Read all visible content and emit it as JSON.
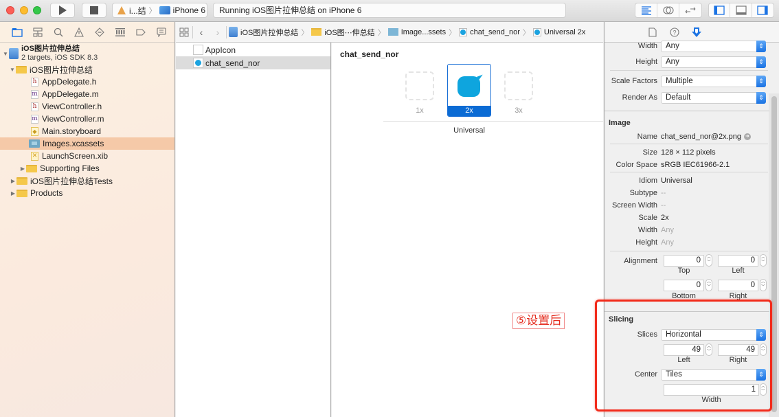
{
  "toolbar": {
    "scheme_target": "i...结",
    "scheme_device": "iPhone 6",
    "activity_text": "Running iOS图片拉伸总结 on iPhone 6",
    "icons": [
      "close-window",
      "minimize-window",
      "zoom-window",
      "run",
      "stop",
      "standard-editor",
      "assistant-editor",
      "version-editor",
      "toggle-navigator",
      "toggle-debug-area",
      "toggle-utilities"
    ]
  },
  "navigator": {
    "tabs": [
      "project-navigator",
      "symbol-navigator",
      "find-navigator",
      "issue-navigator",
      "test-navigator",
      "debug-navigator",
      "breakpoint-navigator",
      "report-navigator"
    ],
    "project": {
      "name": "iOS图片拉伸总结",
      "subtitle": "2 targets, iOS SDK 8.3"
    },
    "items": [
      {
        "label": "iOS图片拉伸总结",
        "type": "folder",
        "expanded": true
      },
      {
        "label": "AppDelegate.h",
        "type": "h"
      },
      {
        "label": "AppDelegate.m",
        "type": "m"
      },
      {
        "label": "ViewController.h",
        "type": "h"
      },
      {
        "label": "ViewController.m",
        "type": "m"
      },
      {
        "label": "Main.storyboard",
        "type": "storyboard"
      },
      {
        "label": "Images.xcassets",
        "type": "xcassets",
        "selected": true
      },
      {
        "label": "LaunchScreen.xib",
        "type": "xib"
      },
      {
        "label": "Supporting Files",
        "type": "folder",
        "expanded": false
      },
      {
        "label": "iOS图片拉伸总结Tests",
        "type": "folder",
        "expanded": false
      },
      {
        "label": "Products",
        "type": "folder",
        "expanded": false
      }
    ]
  },
  "jumpbar": {
    "crumbs": [
      "iOS图片拉伸总结",
      "iOS图⋯伸总结",
      "Image...ssets",
      "chat_send_nor",
      "Universal 2x"
    ]
  },
  "asset_list": {
    "items": [
      {
        "label": "AppIcon",
        "selected": false
      },
      {
        "label": "chat_send_nor",
        "selected": true
      }
    ]
  },
  "asset_detail": {
    "name": "chat_send_nor",
    "slots": [
      "1x",
      "2x",
      "3x"
    ],
    "selected_slot": "2x",
    "idiom": "Universal"
  },
  "annotation": {
    "text": "⑤设置后"
  },
  "inspector": {
    "tabs": [
      "file-inspector",
      "quick-help",
      "attributes-inspector"
    ],
    "width_label": "Width",
    "width_value": "Any",
    "height_label": "Height",
    "height_value": "Any",
    "scale_factors_label": "Scale Factors",
    "scale_factors_value": "Multiple",
    "render_as_label": "Render As",
    "render_as_value": "Default",
    "image_section": "Image",
    "name_label": "Name",
    "name_value": "chat_send_nor@2x.png",
    "size_label": "Size",
    "size_value": "128 × 112 pixels",
    "color_space_label": "Color Space",
    "color_space_value": "sRGB IEC61966-2.1",
    "idiom_label": "Idiom",
    "idiom_value": "Universal",
    "subtype_label": "Subtype",
    "subtype_value": "--",
    "screen_width_label": "Screen Width",
    "screen_width_value": "--",
    "scale_label": "Scale",
    "scale_value": "2x",
    "img_width_label": "Width",
    "img_width_value": "Any",
    "img_height_label": "Height",
    "img_height_value": "Any",
    "alignment_label": "Alignment",
    "alignment": {
      "top": "0",
      "left": "0",
      "bottom": "0",
      "right": "0"
    },
    "alignment_sub": {
      "top": "Top",
      "left": "Left",
      "bottom": "Bottom",
      "right": "Right"
    },
    "slicing_section": "Slicing",
    "slices_label": "Slices",
    "slices_value": "Horizontal",
    "slice_left": "49",
    "slice_right": "49",
    "slice_left_label": "Left",
    "slice_right_label": "Right",
    "center_label": "Center",
    "center_value": "Tiles",
    "center_width": "1",
    "center_width_label": "Width"
  },
  "colors": {
    "accent": "#1b73e3",
    "selection_navigator": "#f5c9a8",
    "asset_blue": "#0ea5de",
    "highlight_red": "#f22b1b"
  }
}
